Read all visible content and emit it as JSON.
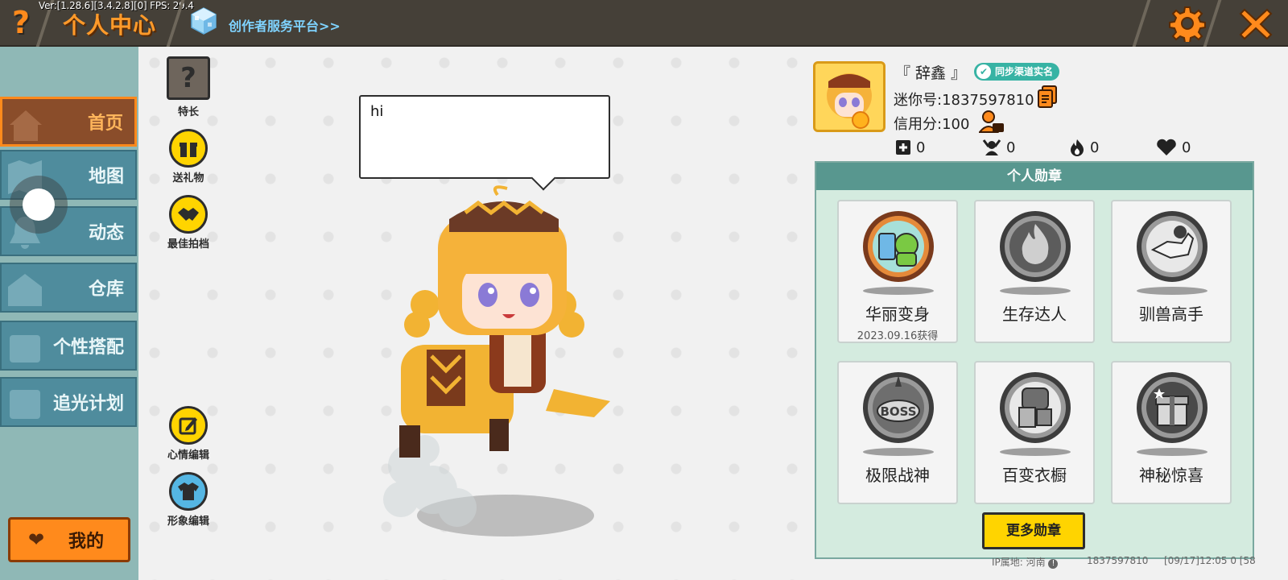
{
  "topbar": {
    "version": "Ver:[1.28.6][3.4.2.8][0] FPS: 29.4",
    "title": "个人中心",
    "help_glyph": "?",
    "creator_link": "创作者服务平台>>",
    "accent": "#ff8a1c"
  },
  "sidebar": {
    "items": [
      {
        "label": "首页",
        "active": true
      },
      {
        "label": "地图",
        "active": false
      },
      {
        "label": "动态",
        "active": false
      },
      {
        "label": "仓库",
        "active": false
      },
      {
        "label": "个性搭配",
        "active": false
      },
      {
        "label": "追光计划",
        "active": false
      }
    ],
    "mine_label": "我的"
  },
  "actions": {
    "specialty": "特长",
    "specialty_glyph": "?",
    "gift": "送礼物",
    "best_partner": "最佳拍档",
    "mood_edit": "心情编辑",
    "image_edit": "形象编辑"
  },
  "speech": {
    "text": "hi"
  },
  "profile": {
    "nickname": "『 辞鑫 』",
    "sync_badge": "同步渠道实名",
    "mini_id": "迷你号:1837597810",
    "credit": "信用分:100",
    "stats": [
      {
        "icon": "add-friend-icon",
        "value": "0"
      },
      {
        "icon": "fans-icon",
        "value": "0"
      },
      {
        "icon": "flame-icon",
        "value": "0"
      },
      {
        "icon": "likes-heart-icon",
        "value": "0"
      }
    ]
  },
  "medals": {
    "header": "个人勋章",
    "items": [
      {
        "name": "华丽变身",
        "date": "2023.09.16获得",
        "unlocked": true
      },
      {
        "name": "生存达人",
        "date": "",
        "unlocked": false
      },
      {
        "name": "驯兽高手",
        "date": "",
        "unlocked": false
      },
      {
        "name": "极限战神",
        "date": "",
        "unlocked": false,
        "emblem_text": "BOSS"
      },
      {
        "name": "百变衣橱",
        "date": "",
        "unlocked": false
      },
      {
        "name": "神秘惊喜",
        "date": "",
        "unlocked": false
      }
    ],
    "more_button": "更多勋章"
  },
  "footer": {
    "ip_location": "IP属地: 河南",
    "account_id": "1837597810",
    "timestamp": "[09/17]12:05 0  [58"
  }
}
